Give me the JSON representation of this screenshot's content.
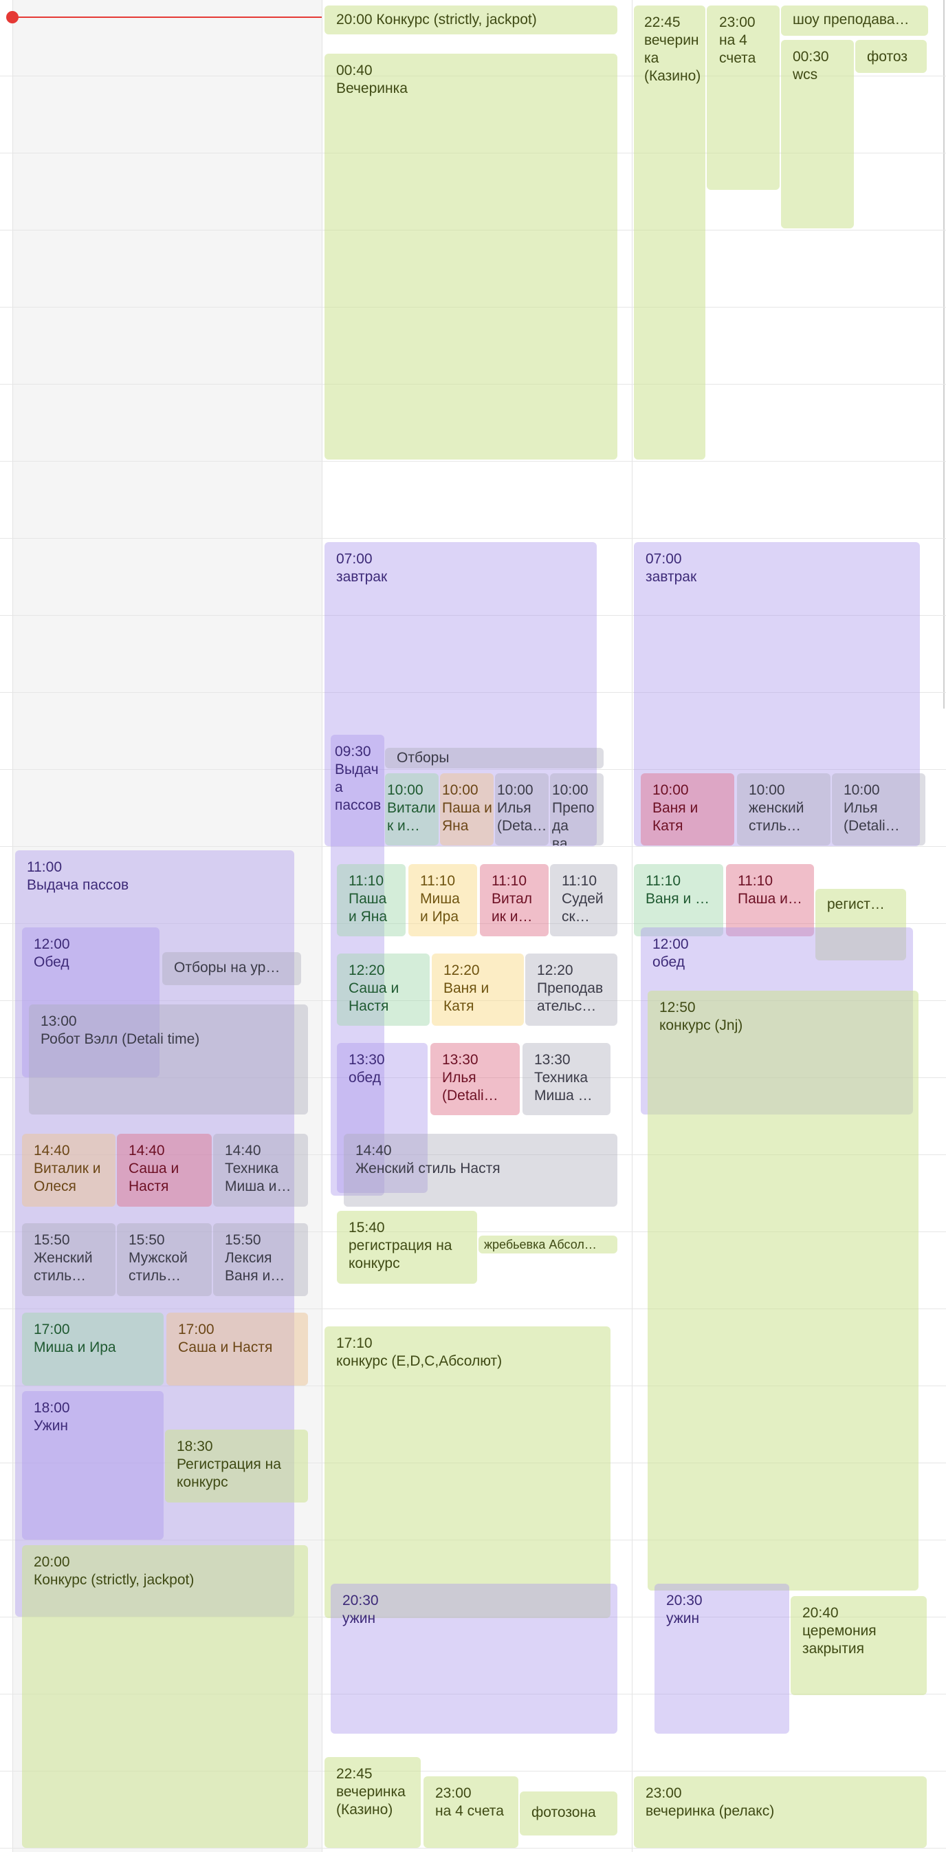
{
  "calendar": {
    "colors": {
      "green": "#e3ebc2",
      "purple": "#ddd5f7",
      "gray": "#e0e0e6",
      "red": "#f2c6d0",
      "yellow": "#fdefc8",
      "mint": "#d6edd9",
      "tan": "#f5e1c9",
      "now_line": "#e53935"
    },
    "events": {
      "c2_strictly_top": {
        "time": "20:00",
        "name": "Конкурс (strictly, jackpot)"
      },
      "c2_party": {
        "time": "00:40",
        "name": "Вечеринка"
      },
      "c2_breakfast": {
        "time": "07:00",
        "name": "завтрак"
      },
      "c2_passes": {
        "time": "09:30",
        "name": "Выдача пассов"
      },
      "c2_otbory": {
        "name": "Отборы"
      },
      "c2_1000_a": {
        "time": "10:00",
        "name": "Виталик и…"
      },
      "c2_1000_b": {
        "time": "10:00",
        "name": "Паша и Яна"
      },
      "c2_1000_c": {
        "time": "10:00",
        "name": "Илья (Deta…"
      },
      "c2_1000_d": {
        "time": "10:00",
        "name": "Препода ва…"
      },
      "c2_1110_a": {
        "time": "11:10",
        "name": "Паша и Яна"
      },
      "c2_1110_b": {
        "time": "11:10",
        "name": "Миша и Ира"
      },
      "c2_1110_c": {
        "time": "11:10",
        "name": "Виталик и…"
      },
      "c2_1110_d": {
        "time": "11:10",
        "name": "Судейск…"
      },
      "c2_1220_a": {
        "time": "12:20",
        "name": "Саша и Настя"
      },
      "c2_1220_b": {
        "time": "12:20",
        "name": "Ваня и Катя"
      },
      "c2_1220_c": {
        "time": "12:20",
        "name": "Преподавательс…"
      },
      "c2_1330_a": {
        "time": "13:30",
        "name": "обед"
      },
      "c2_1330_b": {
        "time": "13:30",
        "name": "Илья (Detali…"
      },
      "c2_1330_c": {
        "time": "13:30",
        "name": "Техника Миша …"
      },
      "c2_1440": {
        "time": "14:40",
        "name": "Женский стиль Настя"
      },
      "c2_1540": {
        "time": "15:40",
        "name": "регистрация на конкурс"
      },
      "c2_draw": {
        "name": "жребьевка Абсол…"
      },
      "c2_1710": {
        "time": "17:10",
        "name": "конкурс (E,D,C,Абсолют)"
      },
      "c2_2030": {
        "time": "20:30",
        "name": "ужин"
      },
      "c2_2245": {
        "time": "22:45",
        "name": "вечеринка (Казино)"
      },
      "c2_2300": {
        "time": "23:00",
        "name": "на 4 счета"
      },
      "c2_photo": {
        "name": "фотозона"
      },
      "c3_2245_top": {
        "time": "22:45",
        "name": "вечеринка (Казино)"
      },
      "c3_2300_top": {
        "time": "23:00",
        "name": "на 4 счета"
      },
      "c3_show": {
        "name": "шоу преподава…"
      },
      "c3_0030": {
        "time": "00:30",
        "name": "wcs"
      },
      "c3_photo_top": {
        "name": "фотоз…"
      },
      "c3_breakfast": {
        "time": "07:00",
        "name": "завтрак"
      },
      "c3_1000_a": {
        "time": "10:00",
        "name": "Ваня и Катя"
      },
      "c3_1000_b": {
        "time": "10:00",
        "name": "женский стиль…"
      },
      "c3_1000_c": {
        "time": "10:00",
        "name": "Илья (Detali…"
      },
      "c3_1110_a": {
        "time": "11:10",
        "name": "Ваня и …"
      },
      "c3_1110_b": {
        "time": "11:10",
        "name": "Паша и…"
      },
      "c3_reg": {
        "name": "регист…"
      },
      "c3_lunch": {
        "time": "12:00",
        "name": "обед"
      },
      "c3_1250": {
        "time": "12:50",
        "name": "конкурс (Jnj)"
      },
      "c3_2030": {
        "time": "20:30",
        "name": "ужин"
      },
      "c3_2040": {
        "time": "20:40",
        "name": "церемония закрытия"
      },
      "c3_2300": {
        "time": "23:00",
        "name": "вечеринка (релакс)"
      },
      "c1_passes": {
        "time": "11:00",
        "name": "Выдача пассов"
      },
      "c1_lunch": {
        "time": "12:00",
        "name": "Обед"
      },
      "c1_otbory": {
        "name": "Отборы на ур…"
      },
      "c1_robot": {
        "time": "13:00",
        "name": "Робот Вэлл (Detali time)"
      },
      "c1_1440_a": {
        "time": "14:40",
        "name": "Виталик и Олеся"
      },
      "c1_1440_b": {
        "time": "14:40",
        "name": "Саша и Настя"
      },
      "c1_1440_c": {
        "time": "14:40",
        "name": "Техника Миша и…"
      },
      "c1_1550_a": {
        "time": "15:50",
        "name": "Женский стиль…"
      },
      "c1_1550_b": {
        "time": "15:50",
        "name": "Мужской стиль…"
      },
      "c1_1550_c": {
        "time": "15:50",
        "name": "Лексия Ваня и…"
      },
      "c1_1700_a": {
        "time": "17:00",
        "name": "Миша и Ира"
      },
      "c1_1700_b": {
        "time": "17:00",
        "name": "Саша и Настя"
      },
      "c1_dinner": {
        "time": "18:00",
        "name": "Ужин"
      },
      "c1_1830": {
        "time": "18:30",
        "name": "Регистрация на конкурс"
      },
      "c1_2000": {
        "time": "20:00",
        "name": "Конкурс (strictly, jackpot)"
      }
    }
  }
}
